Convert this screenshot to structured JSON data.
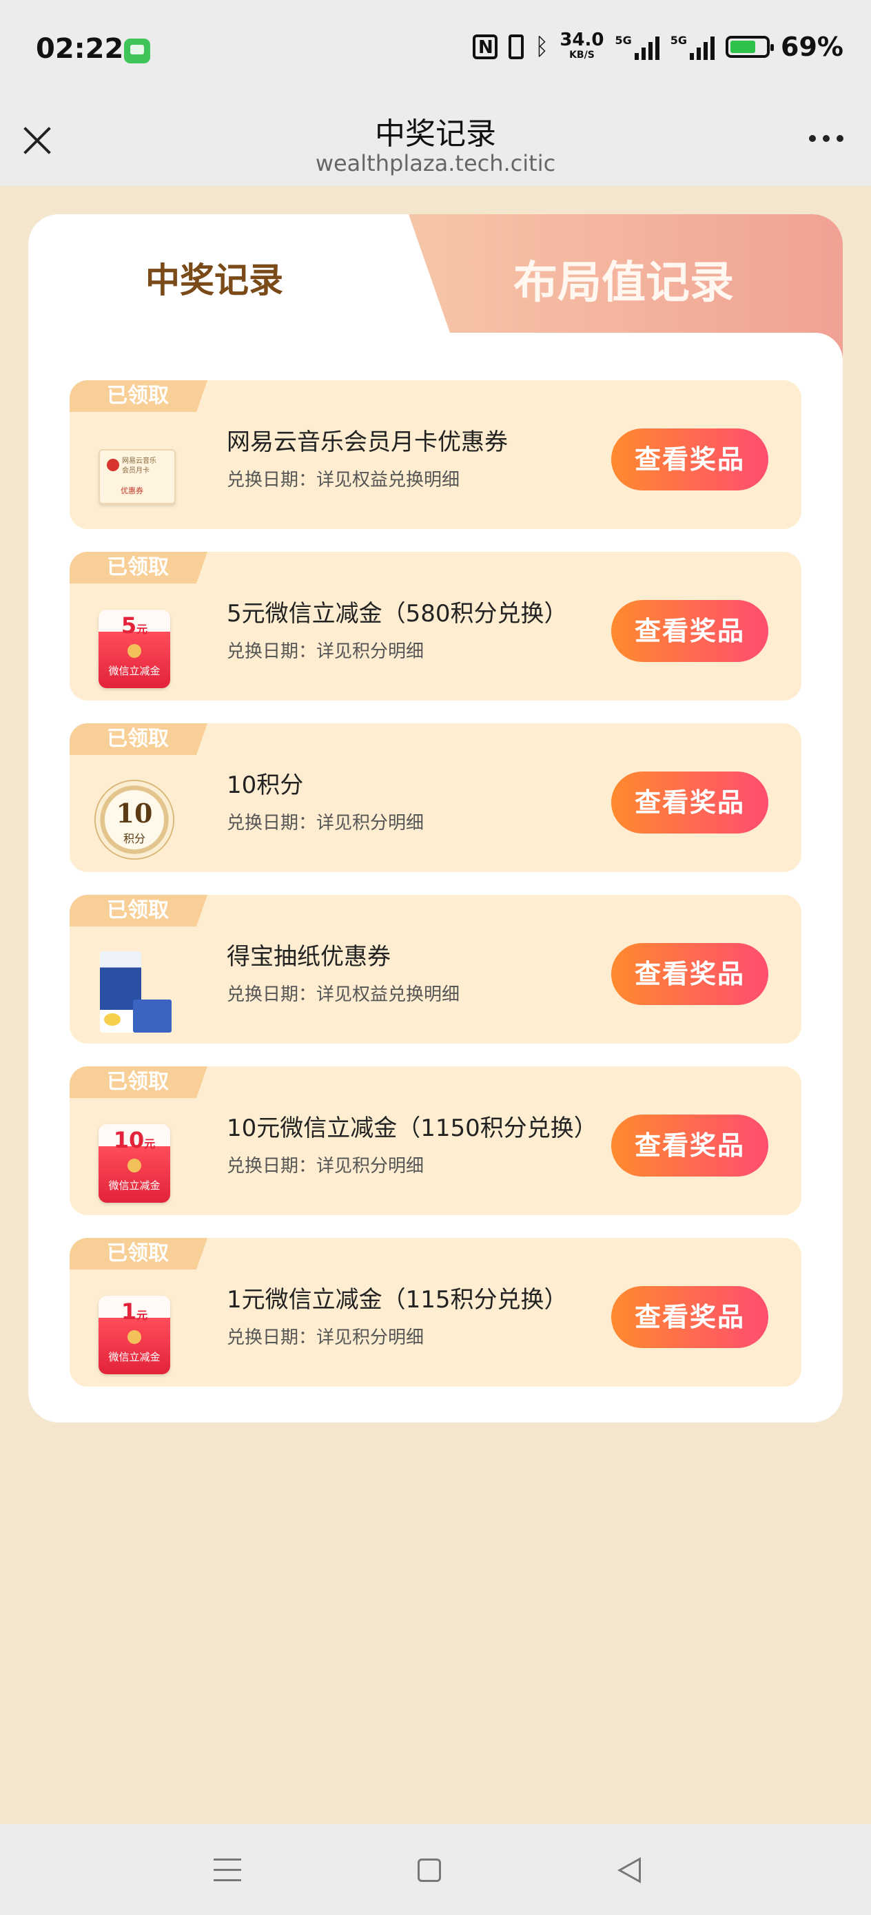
{
  "status_bar": {
    "time": "02:22",
    "net_speed_value": "34.0",
    "net_speed_unit": "KB/S",
    "sim1_label": "5G",
    "sim2_label": "5G",
    "battery_percent": "69%",
    "battery_level": 0.69
  },
  "header": {
    "title": "中奖记录",
    "url": "wealthplaza.tech.citic"
  },
  "tabs": [
    {
      "label": "中奖记录",
      "active": true
    },
    {
      "label": "布局值记录",
      "active": false
    }
  ],
  "prizes": [
    {
      "badge": "已领取",
      "title": "网易云音乐会员月卡优惠券",
      "date": "兑换日期：详见权益兑换明细",
      "button": "查看奖品",
      "thumb": {
        "line1": "网易云音乐",
        "line2": "会员月卡",
        "line3": "优惠券"
      }
    },
    {
      "badge": "已领取",
      "title": "5元微信立减金（580积分兑换）",
      "date": "兑换日期：详见积分明细",
      "button": "查看奖品",
      "thumb": {
        "amount": "5",
        "unit": "元",
        "label": "微信立减金"
      }
    },
    {
      "badge": "已领取",
      "title": "10积分",
      "date": "兑换日期：详见积分明细",
      "button": "查看奖品",
      "thumb": {
        "amount": "10",
        "unit": "积分"
      }
    },
    {
      "badge": "已领取",
      "title": "得宝抽纸优惠券",
      "date": "兑换日期：详见权益兑换明细",
      "button": "查看奖品",
      "thumb": {}
    },
    {
      "badge": "已领取",
      "title": "10元微信立减金（1150积分兑换）",
      "date": "兑换日期：详见积分明细",
      "button": "查看奖品",
      "thumb": {
        "amount": "10",
        "unit": "元",
        "label": "微信立减金"
      }
    },
    {
      "badge": "已领取",
      "title": "1元微信立减金（115积分兑换）",
      "date": "兑换日期：详见积分明细",
      "button": "查看奖品",
      "thumb": {
        "amount": "1",
        "unit": "元",
        "label": "微信立减金"
      }
    }
  ],
  "colors": {
    "page_bg": "#f4e6cc",
    "row_bg": "#feedd0",
    "button_gradient_start": "#ff8a2e",
    "button_gradient_end": "#ff4d70",
    "badge_bg": "#f8cf96",
    "active_tab_text": "#7a4a18"
  },
  "nav_bar": {
    "icons": [
      "menu-icon",
      "home-icon",
      "back-icon"
    ]
  }
}
